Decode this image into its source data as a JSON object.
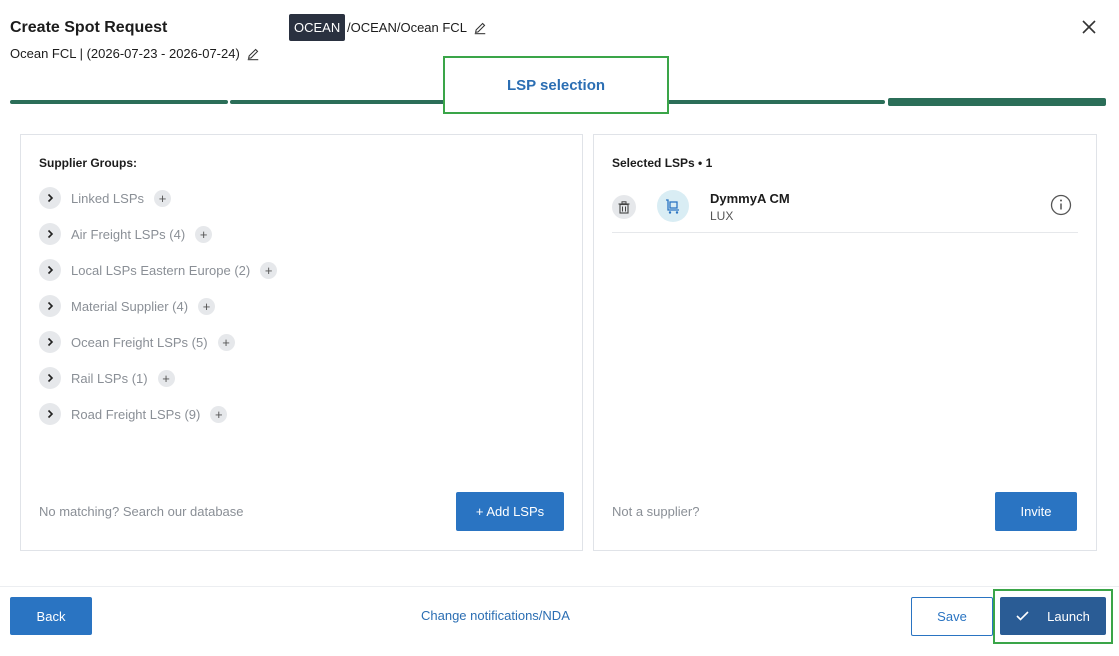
{
  "header": {
    "title": "Create Spot Request",
    "subtitle": "Ocean FCL | (2026-07-23 - 2026-07-24)",
    "mode_badge": "OCEAN",
    "mode_path": "/OCEAN/Ocean FCL"
  },
  "stepper": {
    "active_label": "LSP selection"
  },
  "left_panel": {
    "heading": "Supplier Groups:",
    "groups": [
      {
        "label": "Linked LSPs"
      },
      {
        "label": "Air Freight LSPs (4)"
      },
      {
        "label": "Local LSPs Eastern Europe (2)"
      },
      {
        "label": "Material Supplier (4)"
      },
      {
        "label": "Ocean Freight LSPs (5)"
      },
      {
        "label": "Rail LSPs (1)"
      },
      {
        "label": "Road Freight LSPs (9)"
      }
    ],
    "footer_text": "No matching? Search our database",
    "add_button": "+ Add LSPs"
  },
  "right_panel": {
    "heading": "Selected LSPs • 1",
    "lsps": [
      {
        "name": "DymmyA CM",
        "country": "LUX"
      }
    ],
    "footer_text": "Not a supplier?",
    "invite_button": "Invite"
  },
  "footer": {
    "back": "Back",
    "notifications_link": "Change notifications/NDA",
    "save": "Save",
    "launch": "Launch"
  },
  "colors": {
    "primary": "#2a74c2",
    "launch": "#2a5c95",
    "stepper": "#2b6e58",
    "highlight": "#3aa548"
  }
}
